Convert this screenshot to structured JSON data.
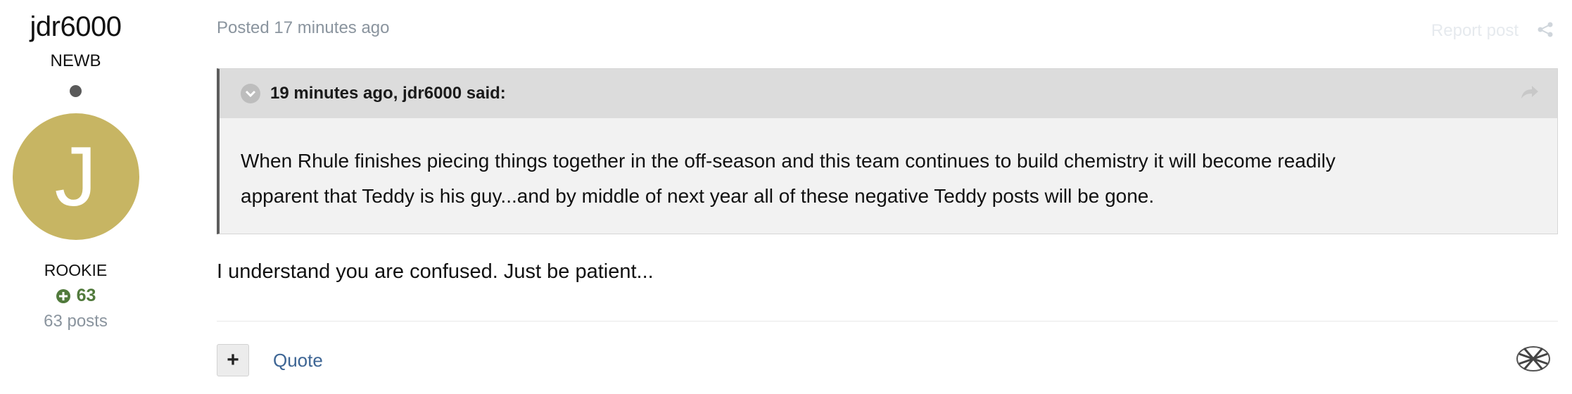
{
  "author": {
    "name": "jdr6000",
    "title": "NEWB",
    "avatar_letter": "J",
    "avatar_color": "#c7b563",
    "rank": "ROOKIE",
    "reputation": "63",
    "posts": "63 posts"
  },
  "post": {
    "meta": "Posted 17 minutes ago",
    "report_label": "Report post",
    "quote": {
      "citation": "19 minutes ago, jdr6000 said:",
      "text_line1": "When Rhule finishes piecing things together in the off-season and this team continues to build chemistry it will become readily",
      "text_line2": "apparent that Teddy is his guy...and by middle of next year all of these negative Teddy posts will be gone."
    },
    "body": "I understand you are confused. Just be patient..."
  },
  "actions": {
    "plus_label": "+",
    "quote_label": "Quote"
  },
  "colors": {
    "reputation": "#517a3c",
    "link": "#3d6594",
    "muted": "#8a949e"
  }
}
